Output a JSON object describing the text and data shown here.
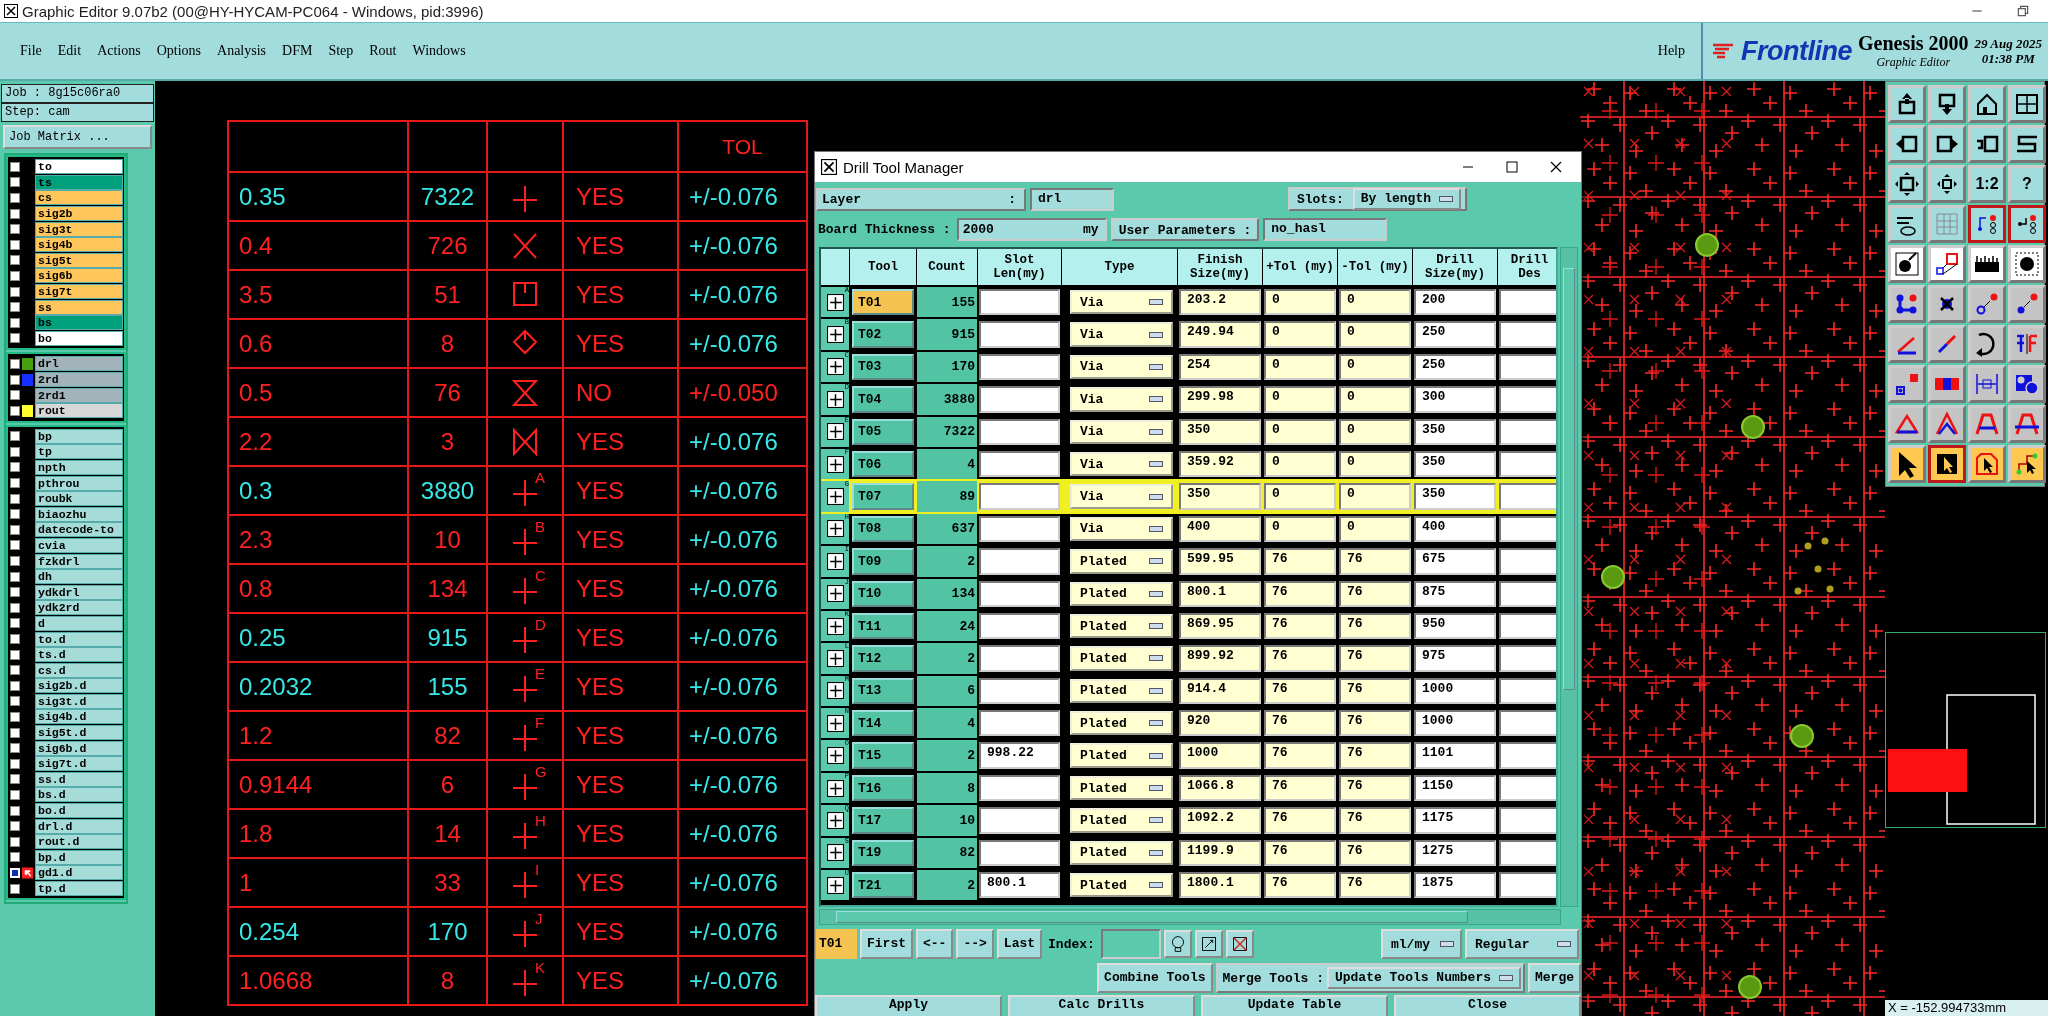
{
  "window": {
    "title": "Graphic Editor 9.07b2 (00@HY-HYCAM-PC064 - Windows, pid:3996)"
  },
  "menu": [
    "File",
    "Edit",
    "Actions",
    "Options",
    "Analysis",
    "DFM",
    "Step",
    "Rout",
    "Windows"
  ],
  "help": "Help",
  "brand": {
    "logo": "Frontline",
    "product": "Genesis 2000",
    "subtitle": "Graphic Editor",
    "date": "29 Aug 2025",
    "time": "01:38 PM"
  },
  "left_panel": {
    "job": "Job : 8g15c06ra0",
    "step": "Step: cam",
    "job_matrix": "Job Matrix ...",
    "layer_groups": [
      {
        "layers": [
          {
            "name": "to",
            "kind": "silk",
            "active": false
          },
          {
            "name": "ts",
            "kind": "mask",
            "active": false
          },
          {
            "name": "cs",
            "kind": "signal",
            "active": false
          },
          {
            "name": "sig2b",
            "kind": "signal",
            "active": false
          },
          {
            "name": "sig3t",
            "kind": "signal",
            "active": false
          },
          {
            "name": "sig4b",
            "kind": "signal",
            "active": false
          },
          {
            "name": "sig5t",
            "kind": "signal",
            "active": false
          },
          {
            "name": "sig6b",
            "kind": "signal",
            "active": false
          },
          {
            "name": "sig7t",
            "kind": "signal",
            "active": false
          },
          {
            "name": "ss",
            "kind": "signal",
            "active": false
          },
          {
            "name": "bs",
            "kind": "mask",
            "active": false
          },
          {
            "name": "bo",
            "kind": "silk",
            "active": false
          }
        ]
      },
      {
        "layers": [
          {
            "name": "drl",
            "kind": "drill",
            "color": "#44a010",
            "active": false
          },
          {
            "name": "2rd",
            "kind": "drill",
            "color": "#1430ff",
            "active": false
          },
          {
            "name": "2rd1",
            "kind": "drill",
            "active": false
          },
          {
            "name": "rout",
            "kind": "rout",
            "color": "#ffff30",
            "active": false
          }
        ]
      },
      {
        "layers": [
          {
            "name": "bp",
            "kind": "misc",
            "active": false
          },
          {
            "name": "tp",
            "kind": "misc",
            "active": false
          },
          {
            "name": "npth",
            "kind": "misc",
            "active": false
          },
          {
            "name": "pthrou",
            "kind": "misc",
            "active": false
          },
          {
            "name": "roubk",
            "kind": "misc",
            "active": false
          },
          {
            "name": "biaozhu",
            "kind": "misc",
            "active": false
          },
          {
            "name": "datecode-to",
            "kind": "misc",
            "active": false
          },
          {
            "name": "cvia",
            "kind": "misc",
            "active": false
          },
          {
            "name": "fzkdrl",
            "kind": "misc",
            "active": false
          },
          {
            "name": "dh",
            "kind": "misc",
            "active": false
          },
          {
            "name": "ydkdrl",
            "kind": "misc",
            "active": false
          },
          {
            "name": "ydk2rd",
            "kind": "misc",
            "active": false
          },
          {
            "name": "d",
            "kind": "misc",
            "active": false
          },
          {
            "name": "to.d",
            "kind": "misc",
            "active": false
          },
          {
            "name": "ts.d",
            "kind": "misc",
            "active": false
          },
          {
            "name": "cs.d",
            "kind": "misc",
            "active": false
          },
          {
            "name": "sig2b.d",
            "kind": "misc",
            "active": false
          },
          {
            "name": "sig3t.d",
            "kind": "misc",
            "active": false
          },
          {
            "name": "sig4b.d",
            "kind": "misc",
            "active": false
          },
          {
            "name": "sig5t.d",
            "kind": "misc",
            "active": false
          },
          {
            "name": "sig6b.d",
            "kind": "misc",
            "active": false
          },
          {
            "name": "sig7t.d",
            "kind": "misc",
            "active": false
          },
          {
            "name": "ss.d",
            "kind": "misc",
            "active": false
          },
          {
            "name": "bs.d",
            "kind": "misc",
            "active": false
          },
          {
            "name": "bo.d",
            "kind": "misc",
            "active": false
          },
          {
            "name": "drl.d",
            "kind": "misc",
            "active": false
          },
          {
            "name": "rout.d",
            "kind": "misc",
            "active": false
          },
          {
            "name": "bp.d",
            "kind": "misc",
            "active": false
          },
          {
            "name": "gd1.d",
            "kind": "misc",
            "active": true
          },
          {
            "name": "tp.d",
            "kind": "misc",
            "active": false
          }
        ]
      }
    ]
  },
  "drill_chart": {
    "header": "TOL",
    "rows": [
      {
        "size": "0.35",
        "count": "7322",
        "kind": "cross",
        "plated": "YES",
        "tol": {
          "text": "+/-0.076",
          "color": "#38e8e8"
        },
        "color": "#38e8e8"
      },
      {
        "size": "0.4",
        "count": "726",
        "kind": "x",
        "plated": "YES",
        "tol": {
          "text": "+/-0.076",
          "color": "#38e8e8"
        },
        "color": "#ff2020"
      },
      {
        "size": "3.5",
        "count": "51",
        "kind": "square",
        "plated": "YES",
        "tol": {
          "text": "+/-0.076",
          "color": "#38e8e8"
        },
        "color": "#ff2020"
      },
      {
        "size": "0.6",
        "count": "8",
        "kind": "diamond",
        "plated": "YES",
        "tol": {
          "text": "+/-0.076",
          "color": "#38e8e8"
        },
        "color": "#ff2020"
      },
      {
        "size": "0.5",
        "count": "76",
        "kind": "hourglass",
        "plated": "NO",
        "tol": {
          "text": "+/-0.050",
          "color": "#ff2020"
        },
        "color": "#ff2020"
      },
      {
        "size": "2.2",
        "count": "3",
        "kind": "bowtie",
        "plated": "YES",
        "tol": {
          "text": "+/-0.076",
          "color": "#38e8e8"
        },
        "color": "#ff2020"
      },
      {
        "size": "0.3",
        "count": "3880",
        "kind": "cross",
        "letter": "A",
        "plated": "YES",
        "tol": {
          "text": "+/-0.076",
          "color": "#38e8e8"
        },
        "color": "#38e8e8"
      },
      {
        "size": "2.3",
        "count": "10",
        "kind": "cross",
        "letter": "B",
        "plated": "YES",
        "tol": {
          "text": "+/-0.076",
          "color": "#38e8e8"
        },
        "color": "#ff2020"
      },
      {
        "size": "0.8",
        "count": "134",
        "kind": "cross",
        "letter": "C",
        "plated": "YES",
        "tol": {
          "text": "+/-0.076",
          "color": "#38e8e8"
        },
        "color": "#ff2020"
      },
      {
        "size": "0.25",
        "count": "915",
        "kind": "cross",
        "letter": "D",
        "plated": "YES",
        "tol": {
          "text": "+/-0.076",
          "color": "#38e8e8"
        },
        "color": "#38e8e8"
      },
      {
        "size": "0.2032",
        "count": "155",
        "kind": "cross",
        "letter": "E",
        "plated": "YES",
        "tol": {
          "text": "+/-0.076",
          "color": "#38e8e8"
        },
        "color": "#38e8e8"
      },
      {
        "size": "1.2",
        "count": "82",
        "kind": "cross",
        "letter": "F",
        "plated": "YES",
        "tol": {
          "text": "+/-0.076",
          "color": "#38e8e8"
        },
        "color": "#ff2020"
      },
      {
        "size": "0.9144",
        "count": "6",
        "kind": "cross",
        "letter": "G",
        "plated": "YES",
        "tol": {
          "text": "+/-0.076",
          "color": "#38e8e8"
        },
        "color": "#ff2020"
      },
      {
        "size": "1.8",
        "count": "14",
        "kind": "cross",
        "letter": "H",
        "plated": "YES",
        "tol": {
          "text": "+/-0.076",
          "color": "#38e8e8"
        },
        "color": "#ff2020"
      },
      {
        "size": "1",
        "count": "33",
        "kind": "cross",
        "letter": "I",
        "plated": "YES",
        "tol": {
          "text": "+/-0.076",
          "color": "#38e8e8"
        },
        "color": "#ff2020"
      },
      {
        "size": "0.254",
        "count": "170",
        "kind": "cross",
        "letter": "J",
        "plated": "YES",
        "tol": {
          "text": "+/-0.076",
          "color": "#38e8e8"
        },
        "color": "#38e8e8"
      },
      {
        "size": "1.0668",
        "count": "8",
        "kind": "cross",
        "letter": "K",
        "plated": "YES",
        "tol": {
          "text": "+/-0.076",
          "color": "#38e8e8"
        },
        "color": "#ff2020"
      }
    ]
  },
  "dialog": {
    "title": "Drill Tool Manager",
    "layer_label": "Layer",
    "layer_colon": ":",
    "layer": "drl",
    "slots_label": "Slots:",
    "slots": "By length",
    "thickness_label": "Board Thickness :",
    "thickness": "2000",
    "thickness_unit": "my",
    "user_params_label": "User Parameters :",
    "user_params": "no_hasl",
    "columns": [
      "Tool",
      "Count",
      "Slot Len(my)",
      "Type",
      "Finish Size(my)",
      "+Tol (my)",
      "-Tol (my)",
      "Drill Size(my)",
      "Drill Des"
    ],
    "rows": [
      {
        "mark": "A",
        "tool": "T01",
        "count": "155",
        "type": "Via",
        "finish": "203.2",
        "plus_tol": "0",
        "minus_tol": "0",
        "drill_size": "200",
        "selected": true,
        "highlighted": false
      },
      {
        "mark": "B",
        "tool": "T02",
        "count": "915",
        "type": "Via",
        "finish": "249.94",
        "plus_tol": "0",
        "minus_tol": "0",
        "drill_size": "250",
        "selected": false,
        "highlighted": false
      },
      {
        "mark": "C",
        "tool": "T03",
        "count": "170",
        "type": "Via",
        "finish": "254",
        "plus_tol": "0",
        "minus_tol": "0",
        "drill_size": "250",
        "selected": false,
        "highlighted": false
      },
      {
        "mark": "D",
        "tool": "T04",
        "count": "3880",
        "type": "Via",
        "finish": "299.98",
        "plus_tol": "0",
        "minus_tol": "0",
        "drill_size": "300",
        "selected": false,
        "highlighted": false
      },
      {
        "mark": "E",
        "tool": "T05",
        "count": "7322",
        "type": "Via",
        "finish": "350",
        "plus_tol": "0",
        "minus_tol": "0",
        "drill_size": "350",
        "selected": false,
        "highlighted": false
      },
      {
        "mark": "F",
        "tool": "T06",
        "count": "4",
        "type": "Via",
        "finish": "359.92",
        "plus_tol": "0",
        "minus_tol": "0",
        "drill_size": "350",
        "selected": false,
        "highlighted": false
      },
      {
        "mark": "G",
        "tool": "T07",
        "count": "89",
        "type": "Via",
        "finish": "350",
        "plus_tol": "0",
        "minus_tol": "0",
        "drill_size": "350",
        "selected": false,
        "highlighted": true
      },
      {
        "mark": "H",
        "tool": "T08",
        "count": "637",
        "type": "Via",
        "finish": "400",
        "plus_tol": "0",
        "minus_tol": "0",
        "drill_size": "400",
        "selected": false,
        "highlighted": false
      },
      {
        "mark": "I",
        "tool": "T09",
        "count": "2",
        "type": "Plated",
        "finish": "599.95",
        "plus_tol": "76",
        "minus_tol": "76",
        "drill_size": "675",
        "selected": false,
        "highlighted": false
      },
      {
        "mark": "J",
        "tool": "T10",
        "count": "134",
        "type": "Plated",
        "finish": "800.1",
        "plus_tol": "76",
        "minus_tol": "76",
        "drill_size": "875",
        "selected": false,
        "highlighted": false
      },
      {
        "mark": "K",
        "tool": "T11",
        "count": "24",
        "type": "Plated",
        "finish": "869.95",
        "plus_tol": "76",
        "minus_tol": "76",
        "drill_size": "950",
        "selected": false,
        "highlighted": false
      },
      {
        "mark": "L",
        "tool": "T12",
        "count": "2",
        "type": "Plated",
        "finish": "899.92",
        "plus_tol": "76",
        "minus_tol": "76",
        "drill_size": "975",
        "selected": false,
        "highlighted": false
      },
      {
        "mark": "M",
        "tool": "T13",
        "count": "6",
        "type": "Plated",
        "finish": "914.4",
        "plus_tol": "76",
        "minus_tol": "76",
        "drill_size": "1000",
        "selected": false,
        "highlighted": false
      },
      {
        "mark": "N",
        "tool": "T14",
        "count": "4",
        "type": "Plated",
        "finish": "920",
        "plus_tol": "76",
        "minus_tol": "76",
        "drill_size": "1000",
        "selected": false,
        "highlighted": false
      },
      {
        "mark": "O",
        "tool": "T15",
        "count": "2",
        "slot_len": "998.22",
        "type": "Plated",
        "finish": "1000",
        "plus_tol": "76",
        "minus_tol": "76",
        "drill_size": "1101",
        "selected": false,
        "highlighted": false
      },
      {
        "mark": "P",
        "tool": "T16",
        "count": "8",
        "type": "Plated",
        "finish": "1066.8",
        "plus_tol": "76",
        "minus_tol": "76",
        "drill_size": "1150",
        "selected": false,
        "highlighted": false
      },
      {
        "mark": "Q",
        "tool": "T17",
        "count": "10",
        "type": "Plated",
        "finish": "1092.2",
        "plus_tol": "76",
        "minus_tol": "76",
        "drill_size": "1175",
        "selected": false,
        "highlighted": false
      },
      {
        "mark": "S",
        "tool": "T19",
        "count": "82",
        "type": "Plated",
        "finish": "1199.9",
        "plus_tol": "76",
        "minus_tol": "76",
        "drill_size": "1275",
        "selected": false,
        "highlighted": false
      },
      {
        "mark": "U",
        "tool": "T21",
        "count": "2",
        "slot_len": "800.1",
        "type": "Plated",
        "finish": "1800.1",
        "plus_tol": "76",
        "minus_tol": "76",
        "drill_size": "1875",
        "selected": false,
        "highlighted": false
      }
    ],
    "current_tool": "T01",
    "nav": [
      "First",
      "<--",
      "-->",
      "Last"
    ],
    "index_label": "Index:",
    "units": "ml/my",
    "mode": "Regular",
    "combine": "Combine Tools",
    "merge_label": "Merge Tools :",
    "merge_mode": "Update Tools Numbers",
    "merge": "Merge",
    "actions": [
      "Apply",
      "Calc Drills",
      "Update Table",
      "Close"
    ]
  },
  "toolbar": {
    "ratio": "1:2",
    "help": "?"
  },
  "status": "X = -152.994733mm"
}
